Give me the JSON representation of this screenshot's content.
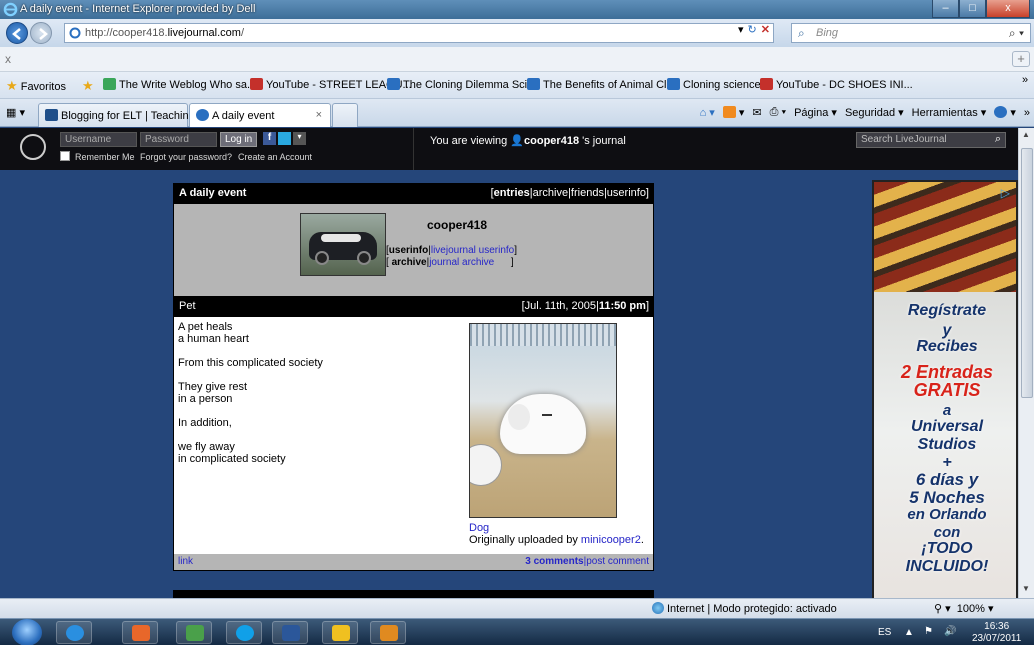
{
  "window": {
    "title": "A daily event - Internet Explorer provided by Dell",
    "minimize": "–",
    "maximize": "□",
    "close": "x"
  },
  "address": {
    "url_prefix": "http://cooper418.",
    "url_domain": "livejournal.com",
    "url_suffix": "/",
    "search_placeholder": "Bing"
  },
  "xrow": {
    "close": "x",
    "plus": "+"
  },
  "favorites": {
    "label": "Favoritos",
    "items": [
      {
        "label": "The Write Weblog Who sa...",
        "color": "#3aa65a"
      },
      {
        "label": "YouTube - STREET LEAGU...",
        "color": "#c4302b"
      },
      {
        "label": "The Cloning Dilemma  Sci...",
        "color": "#2a6fc0"
      },
      {
        "label": "The Benefits of Animal Cl...",
        "color": "#2a6fc0"
      },
      {
        "label": "Cloning science",
        "color": "#2a6fc0"
      },
      {
        "label": "YouTube - DC SHOES INI...",
        "color": "#c4302b"
      }
    ],
    "more": "»"
  },
  "tabs": {
    "items": [
      {
        "label": "Blogging for ELT | Teachin..."
      },
      {
        "label": "A daily event"
      }
    ],
    "close": "×",
    "more": "»"
  },
  "commandbar": {
    "page": "Página ▾",
    "security": "Seguridad ▾",
    "tools": "Herramientas ▾",
    "help": "▾"
  },
  "lj": {
    "username_placeholder": "Username",
    "password_placeholder": "Password",
    "login": "Log in",
    "remember": "Remember Me",
    "forgot": "Forgot your password?",
    "create": "Create an Account",
    "viewing_prefix": "You are viewing",
    "viewing_user": "cooper418",
    "viewing_suffix": "'s journal",
    "search_placeholder": "Search LiveJournal"
  },
  "profile": {
    "title": "A daily event",
    "nav_open": "[",
    "nav_entries": "entries",
    "nav_rest": "|archive|friends|userinfo]",
    "username": "cooper418",
    "links_line1_a": "[",
    "links_line1_b": "userinfo",
    "links_line1_c": "|",
    "links_line1_d": "livejournal userinfo",
    "links_line1_e": "]",
    "links_line2_a": "[ ",
    "links_line2_b": "archive",
    "links_line2_c": "|",
    "links_line2_d": "journal archive",
    "links_line2_e": "      ]"
  },
  "post": {
    "title": "Pet",
    "date_prefix": "[Jul. 11th, 2005|",
    "time": "11:50 pm",
    "date_suffix": "]",
    "body": "A pet heals\na human heart\n\nFrom this complicated society\n\nThey give rest\nin a person\n\nIn addition,\n\nwe fly away\nin complicated society",
    "photo_link": "Dog",
    "uploaded_prefix": "Originally uploaded by ",
    "uploaded_user": "minicooper2",
    "uploaded_suffix": ".",
    "foot_link": "link",
    "comments": "3 comments",
    "post_comment": "|post comment"
  },
  "ad": {
    "line1": "Regístrate",
    "line2": "y",
    "line3": "Recibes",
    "line4": "2 Entradas",
    "line5": "GRATIS",
    "line6": "a",
    "line7": "Universal",
    "line8": "Studios",
    "line9": "+",
    "line10": "6 días y",
    "line11": "5 Noches",
    "line12": "en Orlando",
    "line13": "con",
    "line14": "¡TODO",
    "line15": "INCLUIDO!"
  },
  "status": {
    "zone": "Internet | Modo protegido: activado",
    "zoom": "100%"
  },
  "tray": {
    "lang": "ES",
    "arrow": "▲",
    "time": "16:36",
    "date": "23/07/2011"
  }
}
